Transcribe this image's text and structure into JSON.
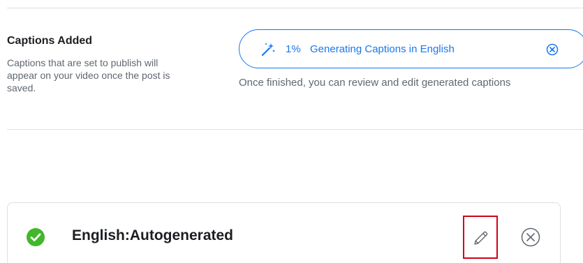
{
  "captions_section": {
    "title": "Captions Added",
    "description": "Captions that are set to publish will appear on your video once the post is saved."
  },
  "progress": {
    "percent_text": "1%",
    "percent_value": 1,
    "label": "Generating Captions in English",
    "helper_text": "Once finished, you can review and edit generated captions"
  },
  "caption_item": {
    "name": "English:Autogenerated",
    "status": "complete"
  },
  "icons": {
    "wand": "magic-wand-icon",
    "pill_close": "close-circle-icon",
    "check": "check-circle-icon",
    "edit": "pencil-icon",
    "remove": "close-circle-icon"
  },
  "colors": {
    "accent": "#1877f2",
    "success": "#42b72a",
    "highlight_border": "#d0021b",
    "muted_text": "#606770",
    "primary_text": "#1c1e21",
    "divider": "#dddfe2"
  }
}
